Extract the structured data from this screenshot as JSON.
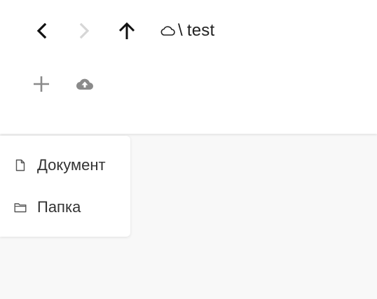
{
  "toolbar": {
    "back_icon": "chevron-left-icon",
    "forward_icon": "chevron-right-icon",
    "up_icon": "arrow-up-icon",
    "new_icon": "plus-icon",
    "upload_icon": "cloud-upload-icon"
  },
  "breadcrumb": {
    "root_icon": "cloud-icon",
    "separator": "\\",
    "current": "test"
  },
  "new_menu": {
    "items": [
      {
        "label": "Документ",
        "icon": "file-icon"
      },
      {
        "label": "Папка",
        "icon": "folder-icon"
      }
    ]
  },
  "colors": {
    "header_bg": "#ffffff",
    "page_bg": "#f8f8f8",
    "icon_active": "#111111",
    "icon_disabled": "#d6d6d6",
    "icon_gray": "#8a8a8a"
  }
}
